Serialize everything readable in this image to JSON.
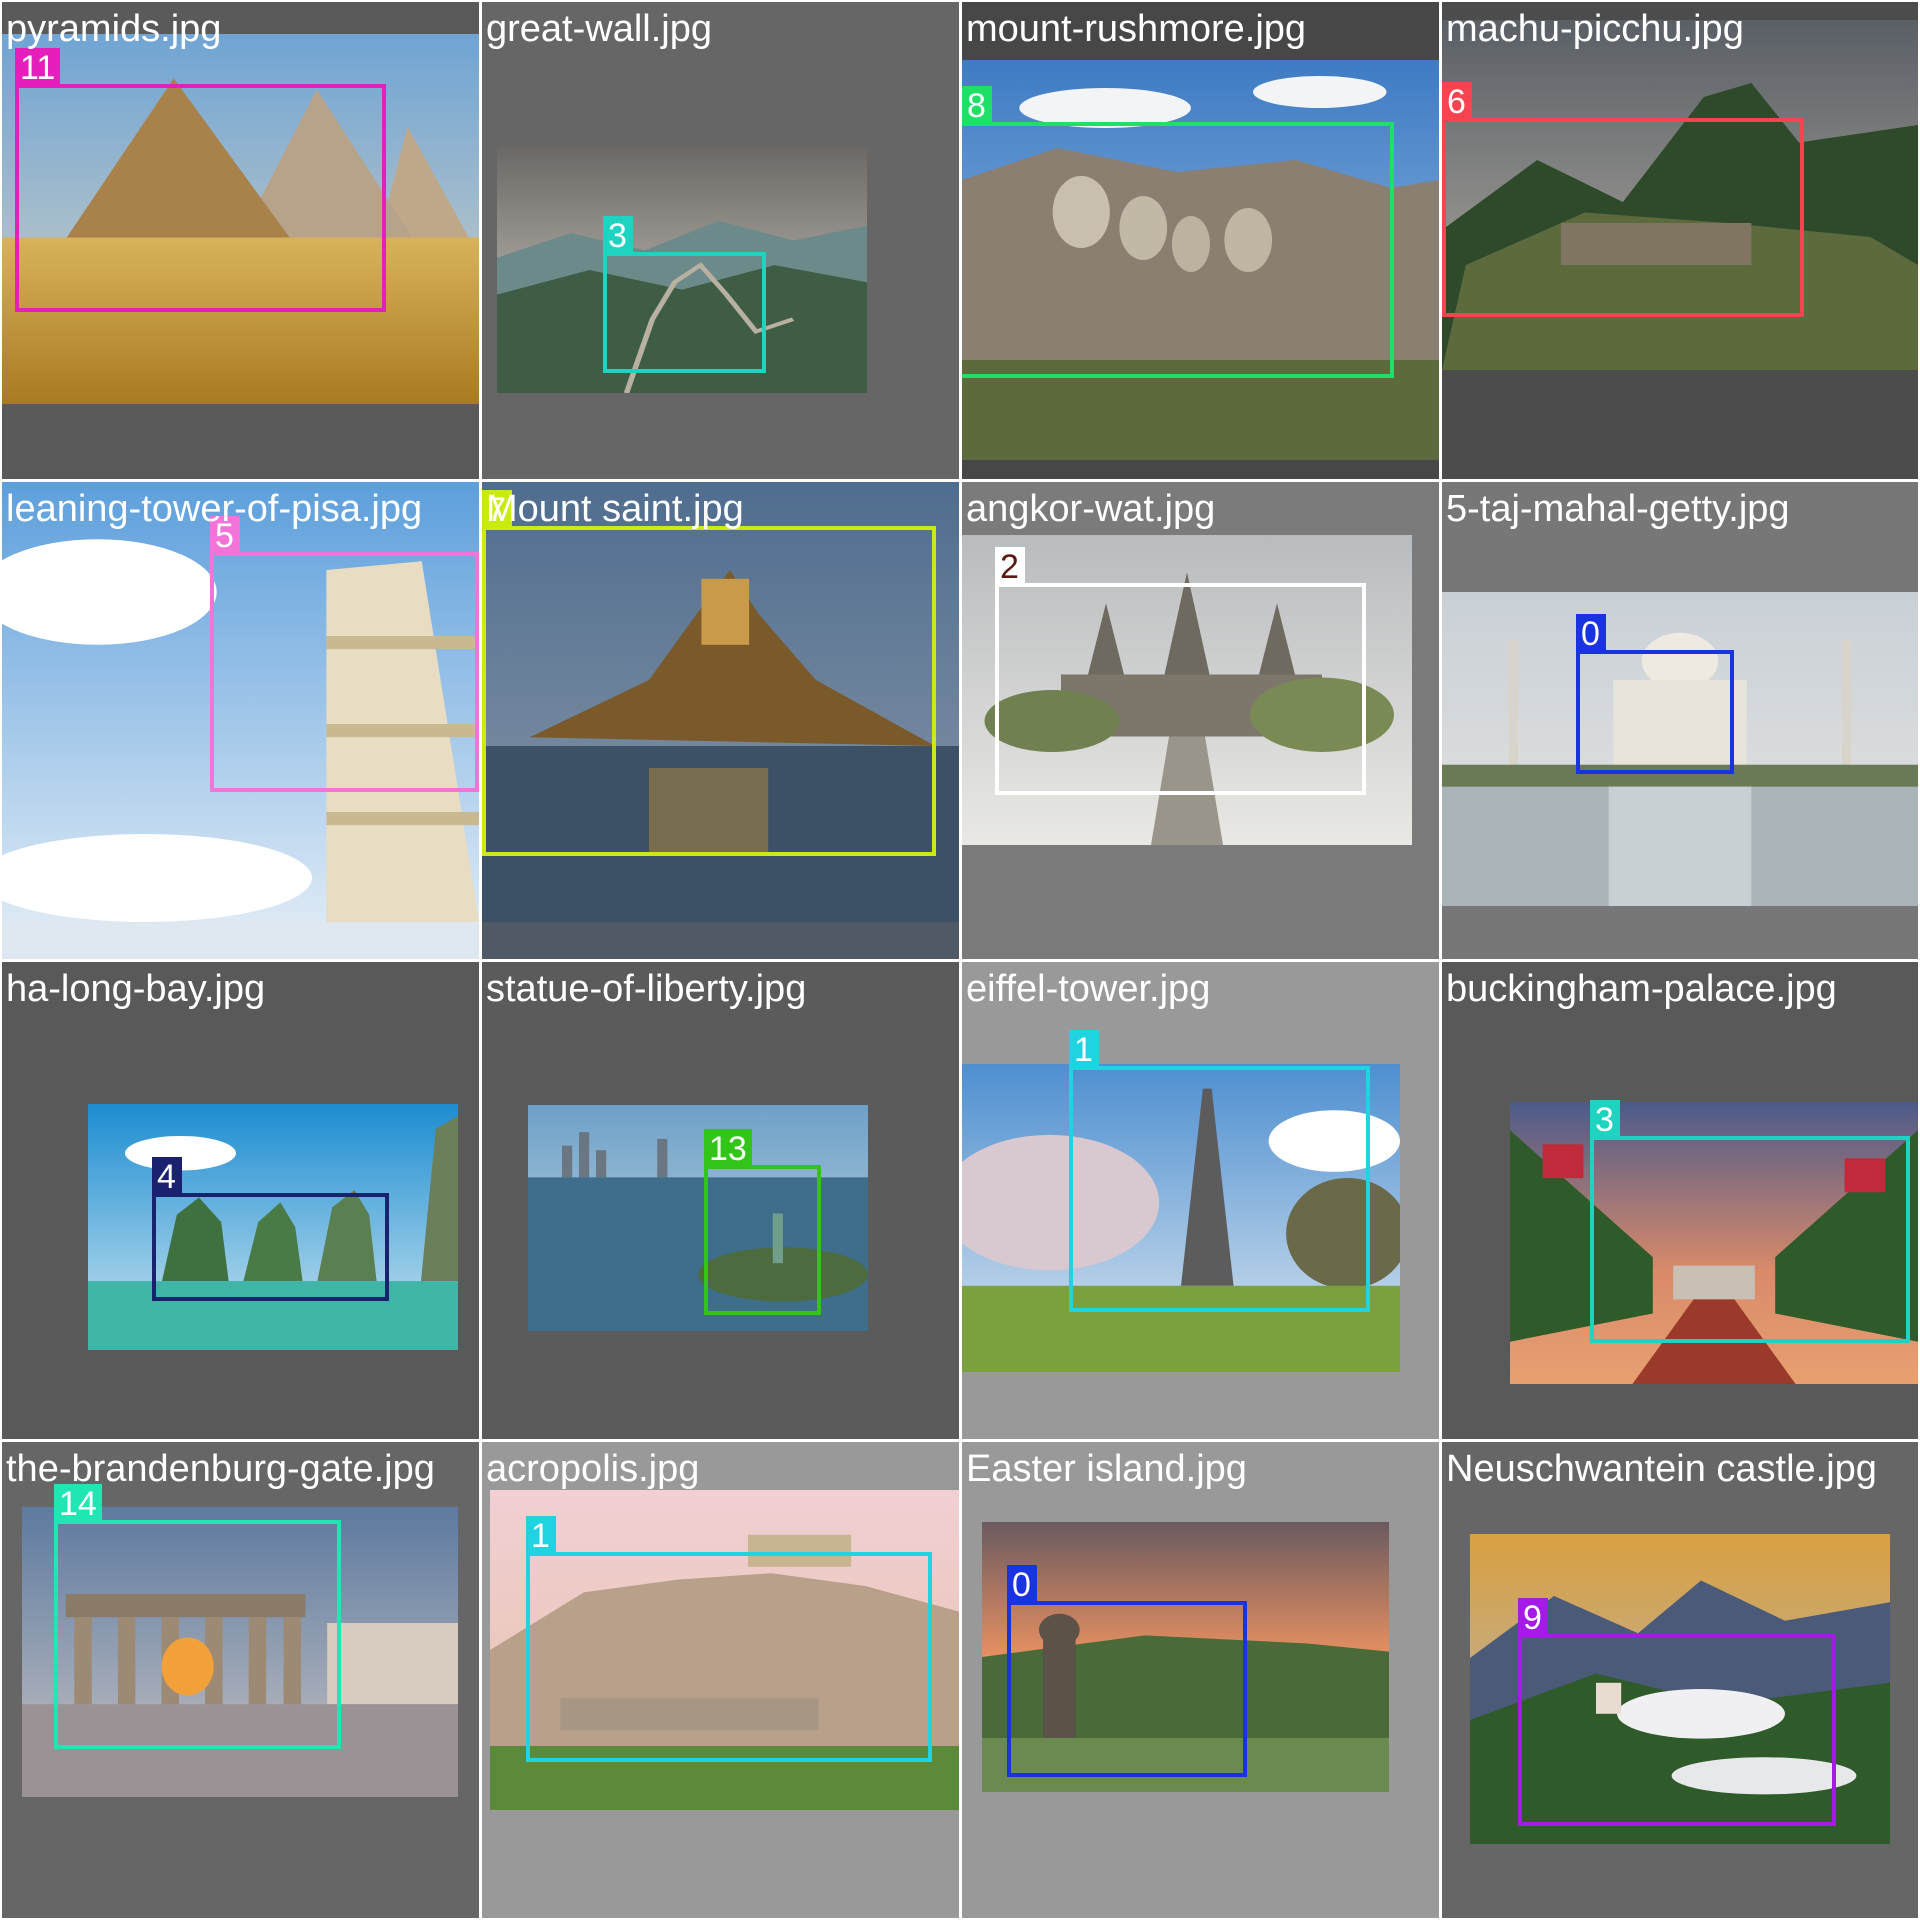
{
  "grid": {
    "cells": [
      {
        "filename": "pyramids.jpg",
        "background": "#5a5a5a",
        "box": {
          "label": "11",
          "color": "#e61ebc",
          "label_text_color": "#ffffff"
        }
      },
      {
        "filename": "great-wall.jpg",
        "background": "#666666",
        "box": {
          "label": "3",
          "color": "#1fd3c1",
          "label_text_color": "#ffffff"
        }
      },
      {
        "filename": "mount-rushmore.jpg",
        "background": "#474747",
        "box": {
          "label": "8",
          "color": "#1fe066",
          "label_text_color": "#ffffff"
        }
      },
      {
        "filename": "machu-picchu.jpg",
        "background": "#4c4c4c",
        "box": {
          "label": "6",
          "color": "#f5434f",
          "label_text_color": "#ffffff"
        }
      },
      {
        "filename": "leaning-tower-of-pisa.jpg",
        "background": "#dfe8f1",
        "box": {
          "label": "5",
          "color": "#f374d9",
          "label_text_color": "#ffffff"
        }
      },
      {
        "filename": "Mount saint.jpg",
        "background": "#505a66",
        "box": {
          "label": "7",
          "color": "#cbeb10",
          "label_text_color": "#ffffff"
        }
      },
      {
        "filename": "angkor-wat.jpg",
        "background": "#7b7b7b",
        "box": {
          "label": "2",
          "color": "#ffffff",
          "label_text_color": "#5a1a0f"
        }
      },
      {
        "filename": "5-taj-mahal-getty.jpg",
        "background": "#777777",
        "box": {
          "label": "0",
          "color": "#1a33e0",
          "label_text_color": "#ffffff"
        }
      },
      {
        "filename": "ha-long-bay.jpg",
        "background": "#595959",
        "box": {
          "label": "4",
          "color": "#1a2270",
          "label_text_color": "#ffffff"
        }
      },
      {
        "filename": "statue-of-liberty.jpg",
        "background": "#5b5b5b",
        "box": {
          "label": "13",
          "color": "#33c41a",
          "label_text_color": "#ffffff"
        }
      },
      {
        "filename": "eiffel-tower.jpg",
        "background": "#999999",
        "box": {
          "label": "1",
          "color": "#1fd3e0",
          "label_text_color": "#ffffff"
        }
      },
      {
        "filename": "buckingham-palace.jpg",
        "background": "#595959",
        "box": {
          "label": "3",
          "color": "#1fd3c1",
          "label_text_color": "#ffffff"
        }
      },
      {
        "filename": "the-brandenburg-gate.jpg",
        "background": "#666666",
        "box": {
          "label": "14",
          "color": "#1fe6b3",
          "label_text_color": "#ffffff"
        }
      },
      {
        "filename": "acropolis.jpg",
        "background": "#999999",
        "box": {
          "label": "1",
          "color": "#1fd3e0",
          "label_text_color": "#ffffff"
        }
      },
      {
        "filename": "Easter island.jpg",
        "background": "#999999",
        "box": {
          "label": "0",
          "color": "#1a33e0",
          "label_text_color": "#ffffff"
        }
      },
      {
        "filename": "Neuschwantein castle.jpg",
        "background": "#666666",
        "box": {
          "label": "9",
          "color": "#a51ae6",
          "label_text_color": "#ffffff"
        }
      }
    ]
  }
}
